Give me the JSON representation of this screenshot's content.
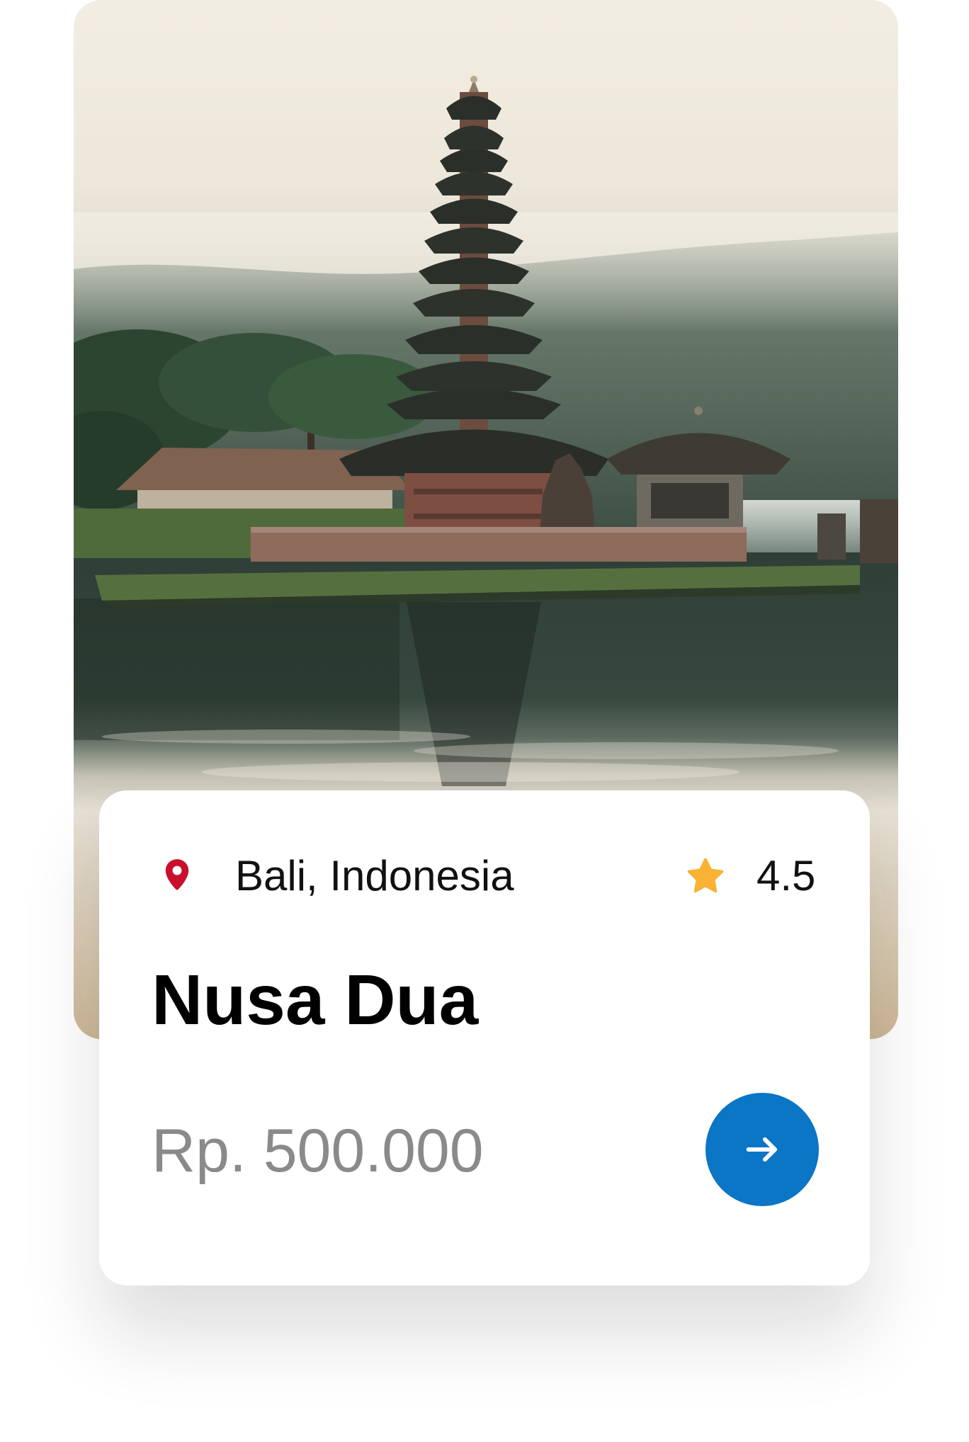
{
  "card": {
    "location": "Bali, Indonesia",
    "rating": "4.5",
    "title": "Nusa Dua",
    "price": "Rp. 500.000"
  },
  "icons": {
    "location": "location-pin-icon",
    "rating": "star-icon",
    "action": "arrow-right-icon"
  },
  "colors": {
    "pin": "#C8102E",
    "star": "#F9B233",
    "button": "#0B75C6",
    "title": "#000000",
    "price": "#8A8A8A",
    "text": "#111111"
  }
}
